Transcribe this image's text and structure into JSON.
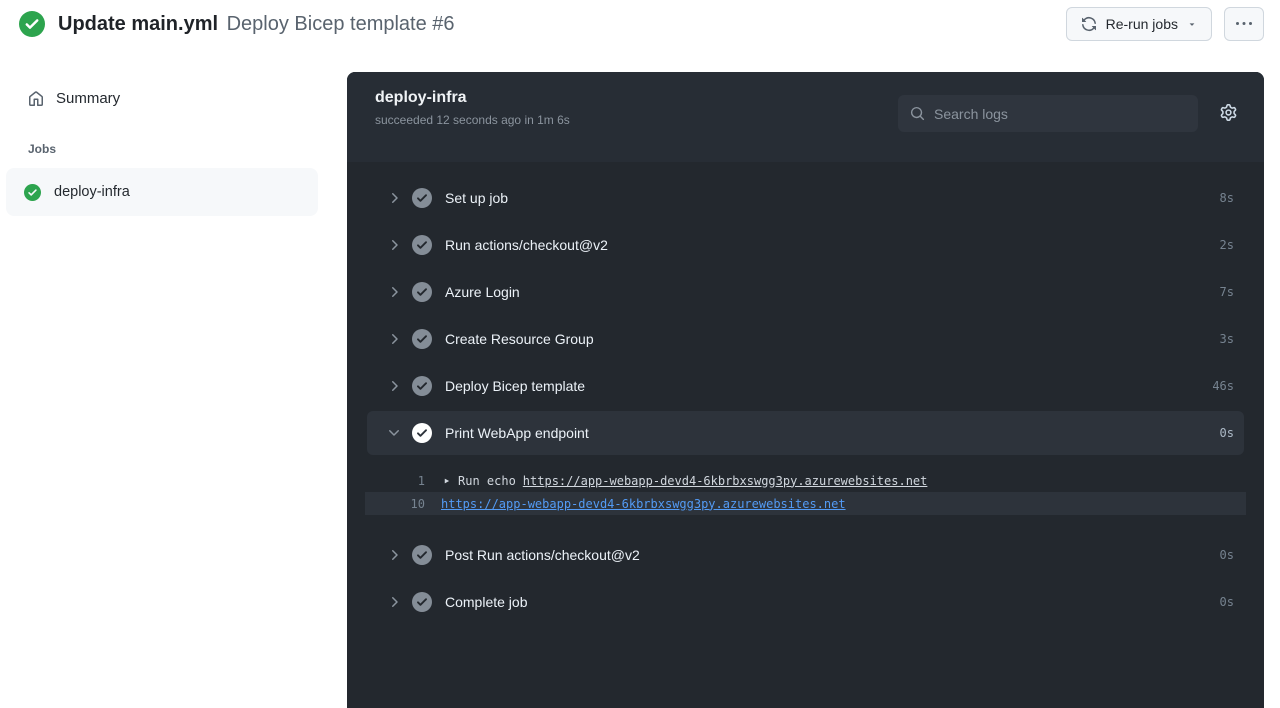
{
  "header": {
    "title_bold": "Update main.yml",
    "run_name": "Deploy Bicep template #6",
    "rerun_button_label": "Re-run jobs",
    "status": "success"
  },
  "sidebar": {
    "summary_label": "Summary",
    "jobs_heading": "Jobs",
    "jobs": [
      {
        "name": "deploy-infra",
        "status": "success"
      }
    ]
  },
  "job_panel": {
    "title": "deploy-infra",
    "status_line": "succeeded 12 seconds ago in 1m 6s",
    "search_placeholder": "Search logs",
    "steps": [
      {
        "label": "Set up job",
        "duration": "8s",
        "status": "success",
        "expanded": false
      },
      {
        "label": "Run actions/checkout@v2",
        "duration": "2s",
        "status": "success",
        "expanded": false
      },
      {
        "label": "Azure Login",
        "duration": "7s",
        "status": "success",
        "expanded": false
      },
      {
        "label": "Create Resource Group",
        "duration": "3s",
        "status": "success",
        "expanded": false
      },
      {
        "label": "Deploy Bicep template",
        "duration": "46s",
        "status": "success",
        "expanded": false
      },
      {
        "label": "Print WebApp endpoint",
        "duration": "0s",
        "status": "success",
        "expanded": true
      },
      {
        "label": "Post Run actions/checkout@v2",
        "duration": "0s",
        "status": "success",
        "expanded": false
      },
      {
        "label": "Complete job",
        "duration": "0s",
        "status": "success",
        "expanded": false
      }
    ],
    "log": {
      "lines": [
        {
          "number": "1",
          "command": "Run echo",
          "url": "https://app-webapp-devd4-6kbrbxswgg3py.azurewebsites.net"
        },
        {
          "number": "10",
          "url": "https://app-webapp-devd4-6kbrbxswgg3py.azurewebsites.net",
          "highlighted": true
        }
      ]
    }
  },
  "icons": {
    "status": "check-circle-fill",
    "home": "home-outline",
    "search": "magnifier",
    "gear": "settings-gear",
    "rerun": "sync-arrows",
    "more": "kebab-horizontal",
    "collapsed": "chevron-right",
    "expanded_chevron": "chevron-down",
    "run_marker": "play-triangle",
    "caret": "triangle-down"
  },
  "colors": {
    "success_green": "#2da44e",
    "panel_body": "#23282e",
    "panel_header": "#272d35",
    "row_highlight": "#2d333b",
    "link_blue": "#539bf5",
    "muted_gray": "#768390"
  }
}
